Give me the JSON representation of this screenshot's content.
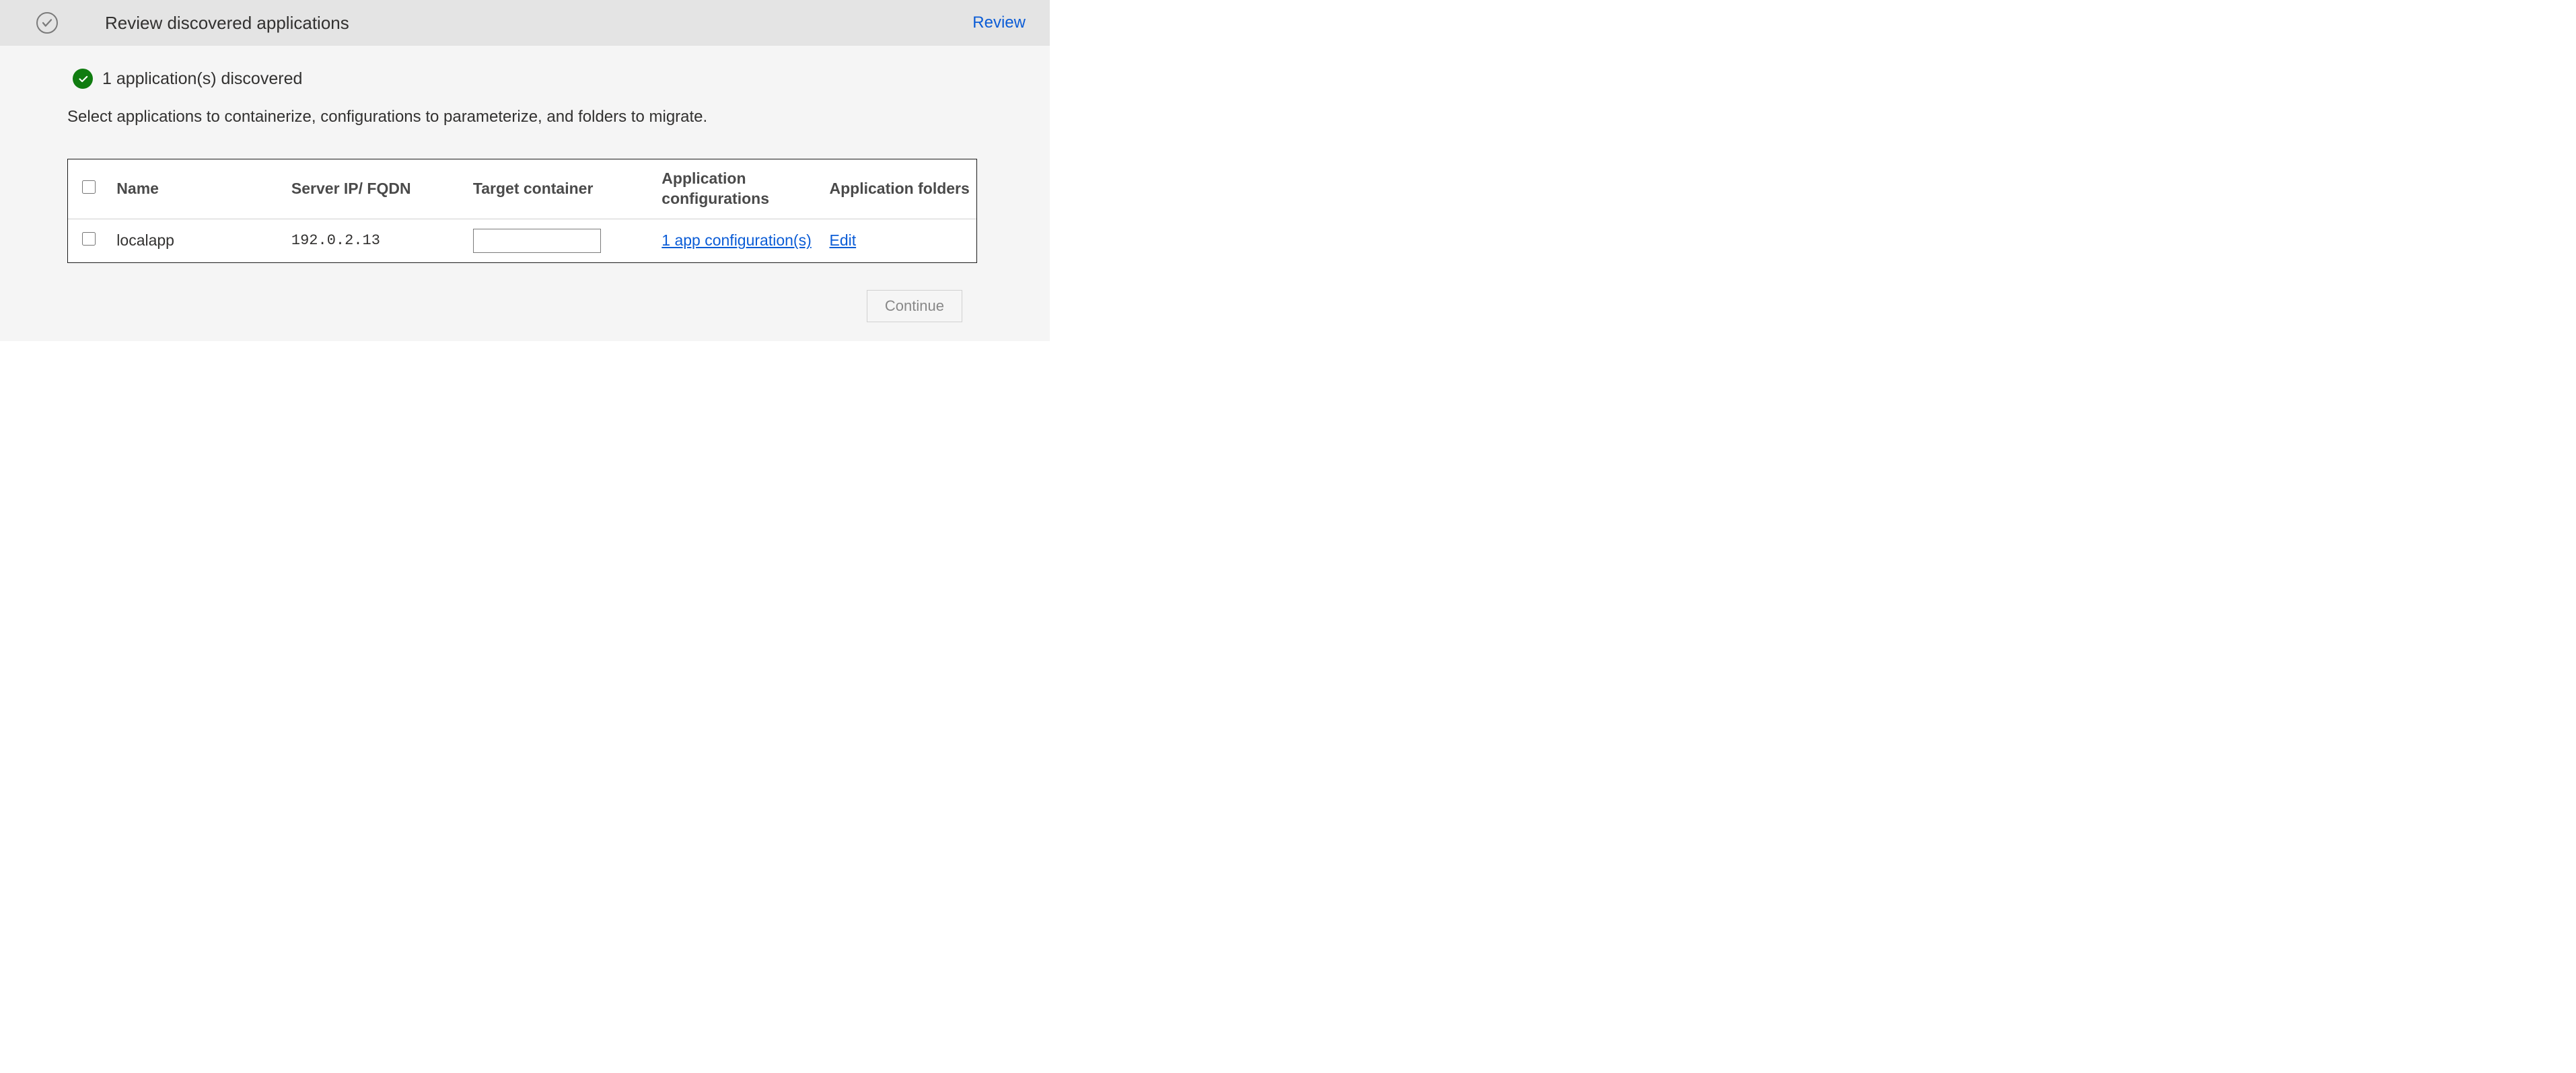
{
  "header": {
    "title": "Review discovered applications",
    "review_link": "Review"
  },
  "status": {
    "discovered_text": "1 application(s) discovered"
  },
  "instruction": "Select applications to containerize, configurations to parameterize, and folders to migrate.",
  "table": {
    "columns": {
      "name": "Name",
      "server": "Server IP/ FQDN",
      "target": "Target container",
      "configs": "Application configurations",
      "folders": "Application folders"
    },
    "rows": [
      {
        "name": "localapp",
        "server": "192.0.2.13",
        "target_value": "",
        "configs_link": "1 app configuration(s)",
        "folders_link": "Edit"
      }
    ]
  },
  "footer": {
    "continue_label": "Continue"
  }
}
